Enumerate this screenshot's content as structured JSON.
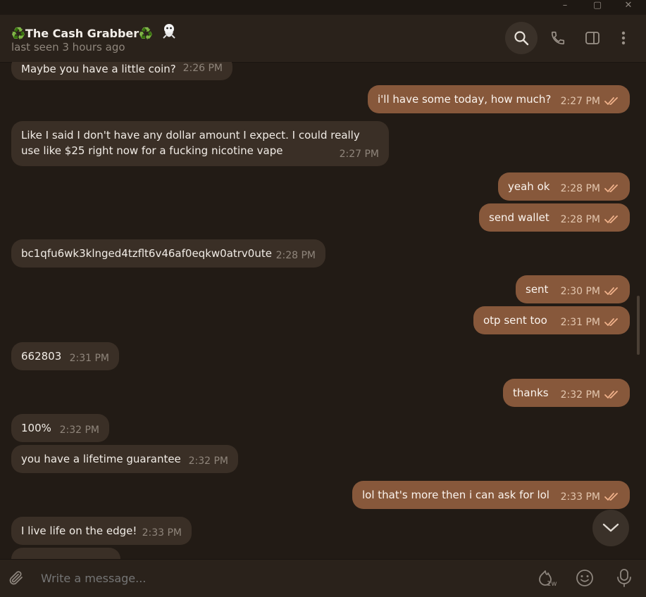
{
  "window": {
    "minimize": "–",
    "maximize": "▢",
    "close": "✕"
  },
  "header": {
    "emoji_left": "♻️",
    "name": "The Cash Grabber",
    "emoji_right": "♻️",
    "status": "last seen 3 hours ago",
    "icons": [
      "search-icon",
      "phone-icon",
      "sidebar-toggle-icon",
      "more-vert-icon"
    ]
  },
  "messages": [
    {
      "dir": "in",
      "text": "Maybe you have a little coin?",
      "time": "2:26 PM"
    },
    {
      "dir": "out",
      "text": "i'll have some today, how much?",
      "time": "2:27 PM",
      "read": true
    },
    {
      "dir": "in",
      "text": "Like I said I don't have any dollar amount I expect. I could really use like $25 right now for a fucking nicotine vape",
      "time": "2:27 PM"
    },
    {
      "dir": "out",
      "text": "yeah ok",
      "time": "2:28 PM",
      "read": true
    },
    {
      "dir": "out",
      "text": "send wallet",
      "time": "2:28 PM",
      "read": true
    },
    {
      "dir": "in",
      "text": "bc1qfu6wk3klnged4tzflt6v46af0eqkw0atrv0ute",
      "time": "2:28 PM"
    },
    {
      "dir": "out",
      "text": "sent",
      "time": "2:30 PM",
      "read": true
    },
    {
      "dir": "out",
      "text": "otp sent too",
      "time": "2:31 PM",
      "read": true
    },
    {
      "dir": "in",
      "text": "662803",
      "time": "2:31 PM"
    },
    {
      "dir": "out",
      "text": "thanks",
      "time": "2:32 PM",
      "read": true
    },
    {
      "dir": "in",
      "text": "100%",
      "time": "2:32 PM"
    },
    {
      "dir": "in",
      "text": "you have a lifetime guarantee",
      "time": "2:32 PM"
    },
    {
      "dir": "out",
      "text": "lol that's more then i can ask for lol",
      "time": "2:33 PM",
      "read": true
    },
    {
      "dir": "in",
      "text": "I live life on the edge!",
      "time": "2:33 PM"
    }
  ],
  "composer": {
    "placeholder": "Write a message...",
    "timer_label": "1w",
    "icons": [
      "attach-icon",
      "timer-icon",
      "emoji-icon",
      "microphone-icon"
    ]
  },
  "colors": {
    "incoming": "#3a2f26",
    "outgoing": "#87583b",
    "background": "#221b15",
    "check": "#f0b18a"
  }
}
